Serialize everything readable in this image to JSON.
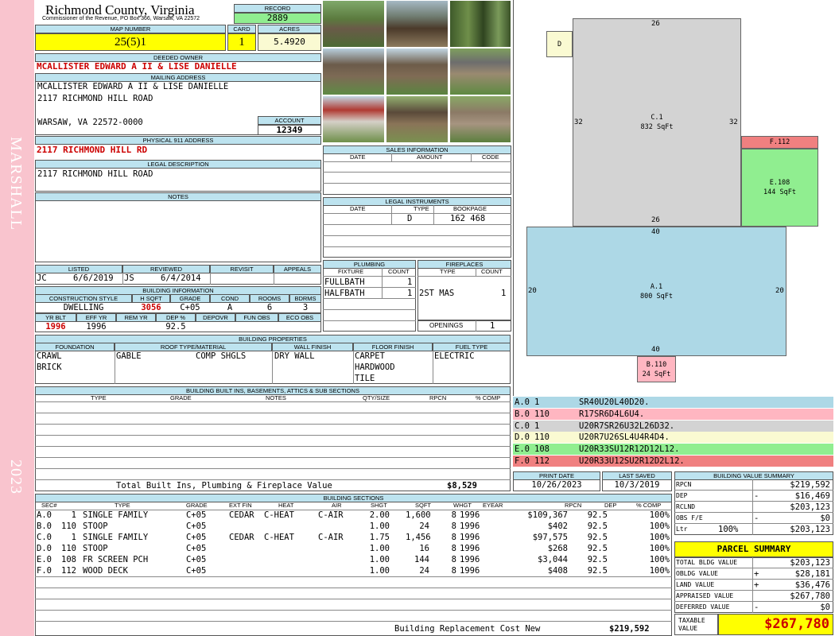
{
  "side": {
    "name": "MARSHALL",
    "year": "2023"
  },
  "header": {
    "county": "Richmond County, Virginia",
    "address": "Commissioner of the Revenue, PO Box 366, Warsaw, VA 22572",
    "record_label": "RECORD",
    "record": "2889",
    "map_label": "MAP NUMBER",
    "map": "25(5)1",
    "card_label": "CARD",
    "card": "1",
    "acres_label": "ACRES",
    "acres": "5.4920"
  },
  "owner": {
    "deeded_label": "DEEDED OWNER",
    "deeded": "MCALLISTER EDWARD A II & LISE DANIELLE",
    "mailing_label": "MAILING ADDRESS",
    "mail1": "MCALLISTER EDWARD A II & LISE DANIELLE",
    "mail2": "2117 RICHMOND HILL ROAD",
    "mail3": "WARSAW, VA 22572-0000",
    "account_label": "ACCOUNT",
    "account": "12349",
    "physical_label": "PHYSICAL 911 ADDRESS",
    "physical": "2117 RICHMOND HILL RD",
    "legal_label": "LEGAL DESCRIPTION",
    "legal": "2117 RICHMOND HILL ROAD",
    "notes_label": "NOTES"
  },
  "photos": [
    "house-front",
    "open-carport",
    "wooded-lot",
    "house-side",
    "house-rear",
    "house-corner",
    "red-carport",
    "log-shed",
    "porch-shed"
  ],
  "sales": {
    "title": "SALES INFORMATION",
    "date": "DATE",
    "amount": "AMOUNT",
    "code": "CODE"
  },
  "instruments": {
    "title": "LEGAL INSTRUMENTS",
    "date": "DATE",
    "type": "TYPE",
    "bookpage": "BOOKPAGE",
    "r_type": "D",
    "r_bookpage": "162 468"
  },
  "review": {
    "listed_label": "LISTED",
    "listed_by": "JC",
    "listed": "6/6/2019",
    "reviewed_label": "REVIEWED",
    "reviewed_by": "JS",
    "reviewed": "6/4/2014",
    "revisit_label": "REVISIT",
    "appeals_label": "APPEALS"
  },
  "plumbing": {
    "title": "PLUMBING",
    "fixture": "FIXTURE",
    "count": "COUNT",
    "r1": "FULLBATH",
    "r1c": "1",
    "r2": "HALFBATH",
    "r2c": "1"
  },
  "fireplaces": {
    "title": "FIREPLACES",
    "type": "TYPE",
    "count": "COUNT",
    "r1": "2ST MAS",
    "r1c": "1",
    "openings_label": "OPENINGS",
    "openings": "1"
  },
  "building_info": {
    "title": "BUILDING INFORMATION",
    "h_style": "CONSTRUCTION STYLE",
    "h_hsqft": "H SQFT",
    "h_grade": "GRADE",
    "h_cond": "COND",
    "h_rooms": "ROOMS",
    "h_bdrms": "BDRMS",
    "style": "DWELLING",
    "hsqft": "3056",
    "grade": "C+05",
    "cond": "A",
    "rooms": "6",
    "bdrms": "3",
    "h_yrblt": "YR BLT",
    "h_effyr": "EFF YR",
    "h_remyr": "REM YR",
    "h_dep": "DEP %",
    "h_depovr": "DEPOVR",
    "h_funobs": "FUN OBS",
    "h_ecoobs": "ECO OBS",
    "yrblt": "1996",
    "effyr": "1996",
    "dep": "92.5"
  },
  "properties": {
    "title": "BUILDING PROPERTIES",
    "h_foundation": "FOUNDATION",
    "h_roof": "ROOF TYPE/MATERIAL",
    "h_wall": "WALL FINISH",
    "h_floor": "FLOOR FINISH",
    "h_fuel": "FUEL TYPE",
    "found1": "CRAWL",
    "found2": "BRICK",
    "roof_type": "GABLE",
    "roof_mat": "COMP SHGLS",
    "wall": "DRY WALL",
    "floor1": "CARPET",
    "floor2": "HARDWOOD",
    "floor3": "TILE",
    "fuel": "ELECTRIC"
  },
  "builtins": {
    "title": "BUILDING BUILT INS, BASEMENTS, ATTICS & SUB SECTIONS",
    "h_type": "TYPE",
    "h_grade": "GRADE",
    "h_notes": "NOTES",
    "h_qty": "QTY/SIZE",
    "h_rpcn": "RPCN",
    "h_comp": "% COMP",
    "total_label": "Total Built Ins, Plumbing & Fireplace Value",
    "total": "$8,529"
  },
  "dates": {
    "print_label": "PRINT DATE",
    "print": "10/26/2023",
    "saved_label": "LAST SAVED",
    "saved": "10/3/2019"
  },
  "sections": {
    "title": "BUILDING SECTIONS",
    "headers": {
      "sec": "SEC#",
      "type": "TYPE",
      "grade": "GRADE",
      "extfin": "EXT FIN",
      "heat": "HEAT",
      "air": "AIR",
      "shgt": "SHGT",
      "sqft": "SQFT",
      "whgt": "WHGT",
      "eyear": "EYEAR",
      "rpcn": "RPCN",
      "dep": "DEP",
      "comp": "% COMP"
    },
    "rows": [
      {
        "sec": "A.0",
        "code": "1",
        "type": "SINGLE FAMILY",
        "grade": "C+05",
        "extfin": "CEDAR",
        "heat": "C-HEAT",
        "air": "C-AIR",
        "shgt": "2.00",
        "sqft": "1,600",
        "whgt": "8",
        "eyear": "1996",
        "rpcn": "$109,367",
        "dep": "92.5",
        "comp": "100%"
      },
      {
        "sec": "B.0",
        "code": "110",
        "type": "STOOP",
        "grade": "C+05",
        "extfin": "",
        "heat": "",
        "air": "",
        "shgt": "1.00",
        "sqft": "24",
        "whgt": "8",
        "eyear": "1996",
        "rpcn": "$402",
        "dep": "92.5",
        "comp": "100%"
      },
      {
        "sec": "C.0",
        "code": "1",
        "type": "SINGLE FAMILY",
        "grade": "C+05",
        "extfin": "CEDAR",
        "heat": "C-HEAT",
        "air": "C-AIR",
        "shgt": "1.75",
        "sqft": "1,456",
        "whgt": "8",
        "eyear": "1996",
        "rpcn": "$97,575",
        "dep": "92.5",
        "comp": "100%"
      },
      {
        "sec": "D.0",
        "code": "110",
        "type": "STOOP",
        "grade": "C+05",
        "extfin": "",
        "heat": "",
        "air": "",
        "shgt": "1.00",
        "sqft": "16",
        "whgt": "8",
        "eyear": "1996",
        "rpcn": "$268",
        "dep": "92.5",
        "comp": "100%"
      },
      {
        "sec": "E.0",
        "code": "108",
        "type": "FR SCREEN PCH",
        "grade": "C+05",
        "extfin": "",
        "heat": "",
        "air": "",
        "shgt": "1.00",
        "sqft": "144",
        "whgt": "8",
        "eyear": "1996",
        "rpcn": "$3,044",
        "dep": "92.5",
        "comp": "100%"
      },
      {
        "sec": "F.0",
        "code": "112",
        "type": "WOOD DECK",
        "grade": "C+05",
        "extfin": "",
        "heat": "",
        "air": "",
        "shgt": "1.00",
        "sqft": "24",
        "whgt": "8",
        "eyear": "1996",
        "rpcn": "$408",
        "dep": "92.5",
        "comp": "100%"
      }
    ],
    "replacement_label": "Building Replacement Cost New",
    "replacement": "$219,592"
  },
  "sketch": {
    "d_label": "D",
    "c_label": "C.1",
    "c_area": "832 SqFt",
    "c_top": "26",
    "c_left": "32",
    "c_right": "32",
    "c_bottom": "26",
    "f_label": "F.112",
    "e_label": "E.108",
    "e_area": "144 SqFt",
    "a_label": "A.1",
    "a_area": "800 SqFt",
    "a_top": "40",
    "a_left": "20",
    "a_right": "20",
    "a_bottom": "40",
    "b_label": "B.110",
    "b_area": "24 SqFt",
    "colors": {
      "a": "#add8e6",
      "b": "#ffb6c1",
      "c": "#d3d3d3",
      "d": "#fafad2",
      "e": "#90ee90",
      "f": "#f08080"
    }
  },
  "vectors": [
    {
      "sec": "A.0",
      "code": "1",
      "vec": "SR40U20L40D20."
    },
    {
      "sec": "B.0",
      "code": "110",
      "vec": "R17SR6D4L6U4."
    },
    {
      "sec": "C.0",
      "code": "1",
      "vec": "U20R7SR26U32L26D32."
    },
    {
      "sec": "D.0",
      "code": "110",
      "vec": "U20R7U26SL4U4R4D4."
    },
    {
      "sec": "E.0",
      "code": "108",
      "vec": "U20R33SU12R12D12L12."
    },
    {
      "sec": "F.0",
      "code": "112",
      "vec": "U20R33U12SU2R12D2L12."
    }
  ],
  "value_summary": {
    "title": "BUILDING VALUE SUMMARY",
    "rpcn_label": "RPCN",
    "rpcn": "$219,592",
    "dep_label": "DEP",
    "dep_sign": "-",
    "dep": "$16,469",
    "rclnd_label": "RCLND",
    "rclnd": "$203,123",
    "obs_label": "OBS F/E",
    "obs_sign": "-",
    "obs": "$0",
    "ltr_label": "Ltr",
    "ltr_pct": "100%",
    "ltr": "$203,123"
  },
  "parcel": {
    "title": "PARCEL SUMMARY",
    "bldg_label": "TOTAL BLDG VALUE",
    "bldg": "$203,123",
    "obldg_label": "OBLDG VALUE",
    "obldg_sign": "+",
    "obldg": "$28,181",
    "land_label": "LAND VALUE",
    "land_sign": "+",
    "land": "$36,476",
    "appraised_label": "APPRAISED VALUE",
    "appraised": "$267,780",
    "deferred_label": "DEFERRED VALUE",
    "deferred_sign": "-",
    "deferred": "$0",
    "taxable_label1": "TAXABLE",
    "taxable_label2": "VALUE",
    "taxable": "$267,780"
  }
}
